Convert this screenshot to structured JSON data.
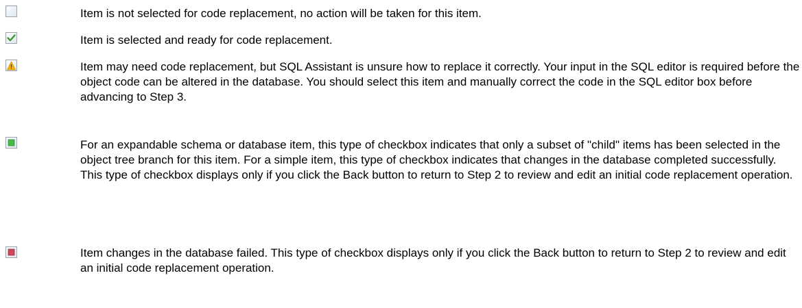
{
  "legend": {
    "items": [
      {
        "icon": "unchecked-checkbox-icon",
        "text": "Item is not selected for code replacement, no action will be taken for this item."
      },
      {
        "icon": "checked-checkbox-icon",
        "text": "Item is selected and ready for code replacement."
      },
      {
        "icon": "warning-checkbox-icon",
        "text": "Item may need code replacement, but SQL Assistant is unsure how to replace  it correctly. Your input in the SQL editor is required before the object code can be altered in the database. You should select this item and manually correct the code in the SQL editor box before advancing to Step 3."
      },
      {
        "icon": "partial-checkbox-icon",
        "text": "For an expandable schema or database item, this type of checkbox indicates that only a subset of \"child\" items has been selected in the object tree branch for this item.  For a simple item, this type of checkbox indicates that changes in the database completed successfully. This type of checkbox displays only if you click the Back button to return to Step 2 to review and edit an initial code replacement operation."
      },
      {
        "icon": "failed-checkbox-icon",
        "text": "Item changes in the database failed. This type of checkbox displays only if you click the Back button to return to Step 2 to review and edit an initial code replacement operation."
      }
    ]
  },
  "colors": {
    "checkbox_border": "#9aa3ad",
    "check_green": "#3a9a2a",
    "warning_yellow": "#f2b400",
    "partial_green": "#4cb84c",
    "failed_red": "#c9485a"
  }
}
